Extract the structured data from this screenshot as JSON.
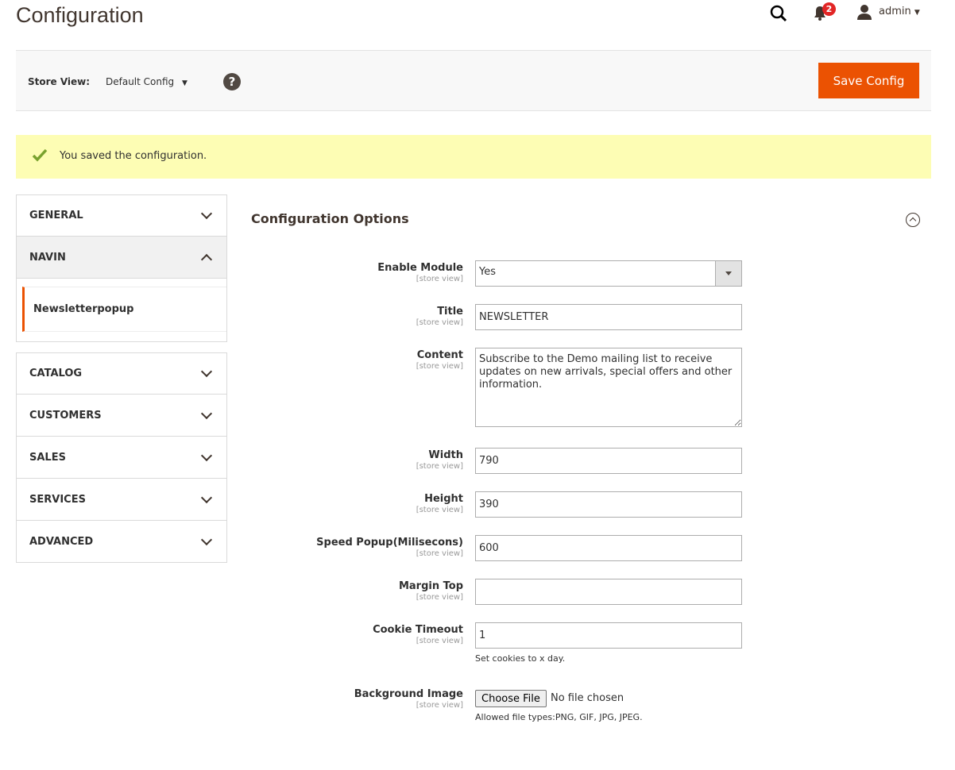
{
  "header": {
    "title": "Configuration",
    "notifications_count": "2",
    "user": "admin"
  },
  "toolbar": {
    "store_view_label": "Store View:",
    "store_view_value": "Default Config",
    "save_label": "Save Config"
  },
  "message": {
    "text": "You saved the configuration.",
    "type": "success"
  },
  "sidebar": {
    "items": [
      {
        "label": "GENERAL",
        "open": false
      },
      {
        "label": "NAVIN",
        "open": true,
        "children": [
          "Newsletterpopup"
        ]
      },
      {
        "label": "CATALOG",
        "open": false
      },
      {
        "label": "CUSTOMERS",
        "open": false
      },
      {
        "label": "SALES",
        "open": false
      },
      {
        "label": "SERVICES",
        "open": false
      },
      {
        "label": "ADVANCED",
        "open": false
      }
    ]
  },
  "section": {
    "title": "Configuration Options",
    "scope": "[store view]",
    "fields": {
      "enable": {
        "label": "Enable Module",
        "value": "Yes"
      },
      "title": {
        "label": "Title",
        "value": "NEWSLETTER"
      },
      "content": {
        "label": "Content",
        "value": "Subscribe to the Demo mailing list to receive updates on new arrivals, special offers and other information."
      },
      "width": {
        "label": "Width",
        "value": "790"
      },
      "height": {
        "label": "Height",
        "value": "390"
      },
      "speed": {
        "label": "Speed Popup(Milisecons)",
        "value": "600"
      },
      "margin": {
        "label": "Margin Top",
        "value": ""
      },
      "cookie": {
        "label": "Cookie Timeout",
        "value": "1",
        "note": "Set cookies to x day."
      },
      "bg": {
        "label": "Background Image",
        "button": "Choose File",
        "status": "No file chosen",
        "note": "Allowed file types:PNG, GIF, JPG, JPEG."
      }
    }
  },
  "colors": {
    "accent": "#eb5202",
    "message_bg": "#fdfdb4",
    "success": "#79a22e"
  }
}
